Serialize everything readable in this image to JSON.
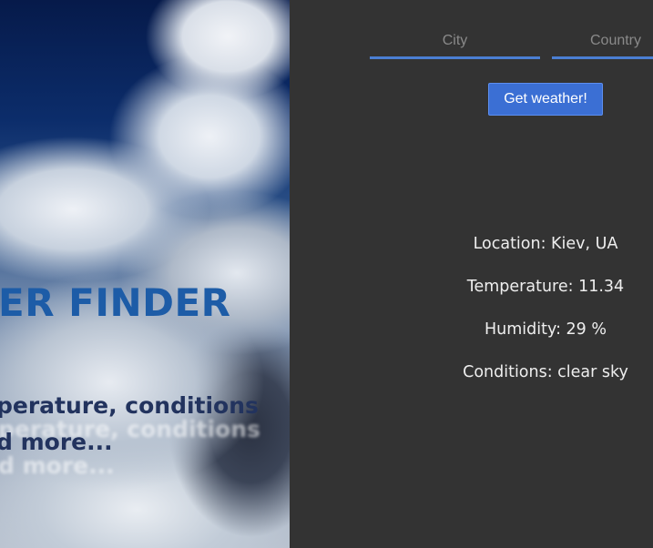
{
  "hero": {
    "title": "ER FINDER",
    "subtitle_line1": "perature, conditions",
    "subtitle_line2": "d more..."
  },
  "form": {
    "city_placeholder": "City",
    "country_placeholder": "Country",
    "submit_label": "Get weather!"
  },
  "results": {
    "location": "Location: Kiev, UA",
    "temperature": "Temperature: 11.34",
    "humidity": "Humidity: 29 %",
    "conditions": "Conditions: clear sky"
  },
  "colors": {
    "panel_bg": "#333333",
    "accent": "#3b6fd4",
    "title": "#1d5ca7"
  }
}
